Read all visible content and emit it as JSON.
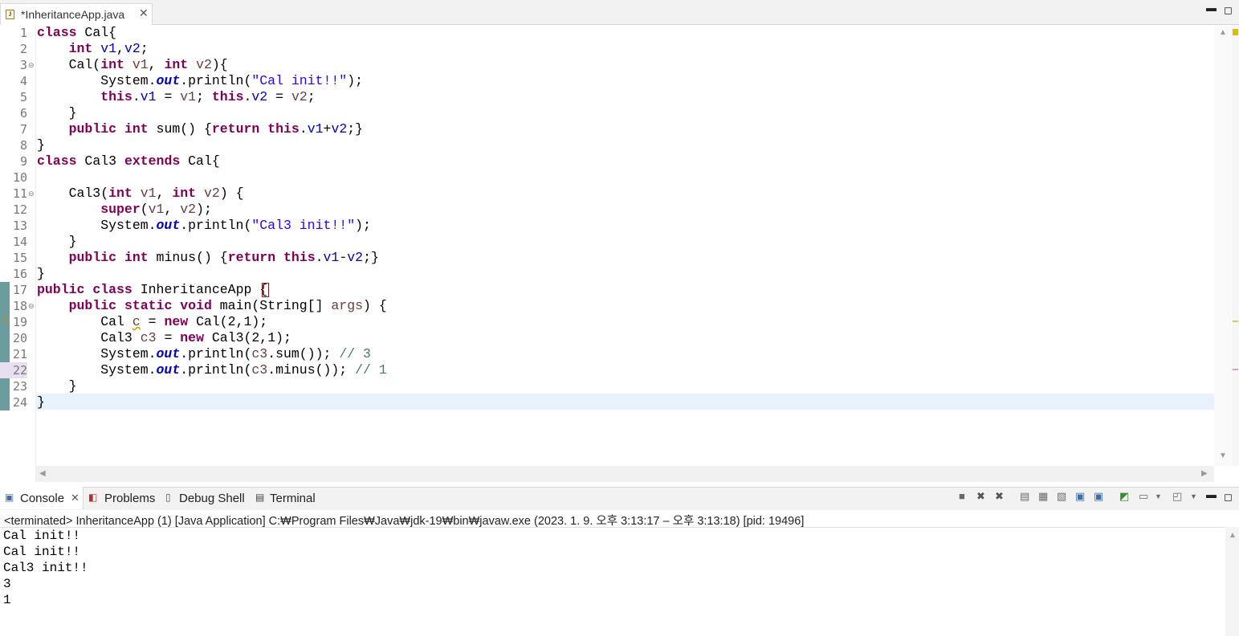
{
  "editor": {
    "tab_title": "*InheritanceApp.java",
    "file_icon_letter": "J",
    "close_glyph": "✕",
    "minimize_glyph": "▬",
    "maximize_glyph": "◻"
  },
  "code_lines": [
    {
      "num": "1",
      "fold": "",
      "html": "<span class='kw'>class</span> Cal{"
    },
    {
      "num": "2",
      "fold": "",
      "html": "    <span class='kw'>int</span> <span class='fld'>v1</span>,<span class='fld'>v2</span>;"
    },
    {
      "num": "3",
      "fold": "⊖",
      "html": "    Cal(<span class='kw'>int</span> <span class='var'>v1</span>, <span class='kw'>int</span> <span class='var'>v2</span>){"
    },
    {
      "num": "4",
      "fold": "",
      "html": "        System.<span class='sfld'>out</span>.println(<span class='str'>\"Cal init!!\"</span>);"
    },
    {
      "num": "5",
      "fold": "",
      "html": "        <span class='kw'>this</span>.<span class='fld'>v1</span> = <span class='var'>v1</span>; <span class='kw'>this</span>.<span class='fld'>v2</span> = <span class='var'>v2</span>;"
    },
    {
      "num": "6",
      "fold": "",
      "html": "    }"
    },
    {
      "num": "7",
      "fold": "",
      "html": "    <span class='kw'>public</span> <span class='kw'>int</span> sum() {<span class='kw'>return</span> <span class='kw'>this</span>.<span class='fld'>v1</span>+<span class='fld'>v2</span>;}"
    },
    {
      "num": "8",
      "fold": "",
      "html": "}"
    },
    {
      "num": "9",
      "fold": "",
      "html": "<span class='kw'>class</span> Cal3 <span class='kw'>extends</span> Cal{"
    },
    {
      "num": "10",
      "fold": "",
      "html": ""
    },
    {
      "num": "11",
      "fold": "⊖",
      "html": "    Cal3(<span class='kw'>int</span> <span class='var'>v1</span>, <span class='kw'>int</span> <span class='var'>v2</span>) {"
    },
    {
      "num": "12",
      "fold": "",
      "html": "        <span class='kw'>super</span>(<span class='var'>v1</span>, <span class='var'>v2</span>);"
    },
    {
      "num": "13",
      "fold": "",
      "html": "        System.<span class='sfld'>out</span>.println(<span class='str'>\"Cal3 init!!\"</span>);"
    },
    {
      "num": "14",
      "fold": "",
      "html": "    }"
    },
    {
      "num": "15",
      "fold": "",
      "html": "    <span class='kw'>public</span> <span class='kw'>int</span> minus() {<span class='kw'>return</span> <span class='kw'>this</span>.<span class='fld'>v1</span>-<span class='fld'>v2</span>;}"
    },
    {
      "num": "16",
      "fold": "",
      "html": "}"
    },
    {
      "num": "17",
      "fold": "",
      "html": "<span class='kw'>public</span> <span class='kw'>class</span> InheritanceApp {"
    },
    {
      "num": "18",
      "fold": "⊖",
      "html": "    <span class='kw'>public</span> <span class='kw'>static</span> <span class='kw'>void</span> main(String[] <span class='var'>args</span>) {"
    },
    {
      "num": "19",
      "fold": "",
      "html": "        Cal <span class='var squig'>c</span> = <span class='kw'>new</span> Cal(2,1);"
    },
    {
      "num": "20",
      "fold": "",
      "html": "        Cal3 <span class='var'>c3</span> = <span class='kw'>new</span> Cal3(2,1);"
    },
    {
      "num": "21",
      "fold": "",
      "html": "        System.<span class='sfld'>out</span>.println(<span class='var'>c3</span>.sum()); <span class='cmt'>// 3</span>"
    },
    {
      "num": "22",
      "fold": "",
      "html": "        System.<span class='sfld'>out</span>.println(<span class='var'>c3</span>.minus()); <span class='cmt'>// 1</span>"
    },
    {
      "num": "23",
      "fold": "",
      "html": "    }"
    },
    {
      "num": "24",
      "fold": "",
      "html": "}"
    }
  ],
  "console": {
    "tabs": [
      {
        "label": "Console",
        "icon": "console-icon"
      },
      {
        "label": "Problems",
        "icon": "problems-icon"
      },
      {
        "label": "Debug Shell",
        "icon": "debug-shell-icon"
      },
      {
        "label": "Terminal",
        "icon": "terminal-icon"
      }
    ],
    "close_glyph": "✕",
    "status": "<terminated> InheritanceApp (1) [Java Application] C:₩Program Files₩Java₩jdk-19₩bin₩javaw.exe  (2023. 1. 9. 오후 3:13:17 – 오후 3:13:18) [pid: 19496]",
    "output": [
      "Cal init!!",
      "Cal init!!",
      "Cal3 init!!",
      "3",
      "1"
    ]
  },
  "colors": {
    "keyword": "#7f0055",
    "field": "#0000c0",
    "string": "#2a00ff",
    "comment": "#3f7f5f",
    "current_line": "#e8f2fe",
    "change_bar": "#6b9c9e"
  }
}
